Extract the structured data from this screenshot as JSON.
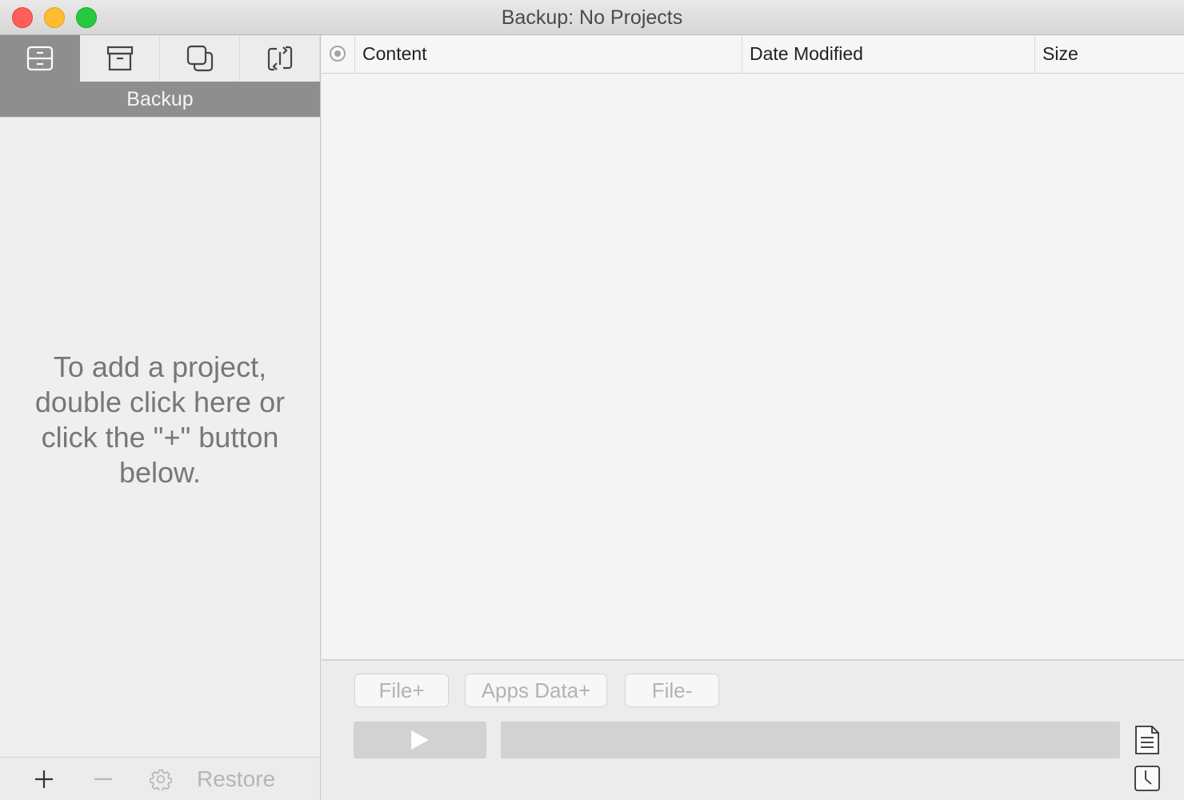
{
  "window": {
    "title": "Backup: No Projects"
  },
  "sidebar": {
    "tabs": [
      {
        "icon": "backup-drawer-icon",
        "active": true
      },
      {
        "icon": "archive-box-icon",
        "active": false
      },
      {
        "icon": "clone-squares-icon",
        "active": false
      },
      {
        "icon": "sync-arrows-icon",
        "active": false
      }
    ],
    "active_tab_label": "Backup",
    "empty_hint": "To add a project, double click here or click the \"+\" button below.",
    "footer": {
      "add_icon": "plus-icon",
      "remove_icon": "minus-icon",
      "settings_icon": "gear-icon",
      "restore_label": "Restore"
    }
  },
  "content_table": {
    "columns": [
      "Content",
      "Date Modified",
      "Size"
    ],
    "rows": []
  },
  "actions": {
    "file_add_label": "File+",
    "apps_data_add_label": "Apps Data+",
    "file_remove_label": "File-"
  },
  "progress": {
    "value": 0
  },
  "colors": {
    "active_tab_bg": "#8e8e8e",
    "disabled_text": "#b5b5b5",
    "close": "#fe5f57",
    "minimize": "#febc2e",
    "zoom": "#28c840"
  }
}
